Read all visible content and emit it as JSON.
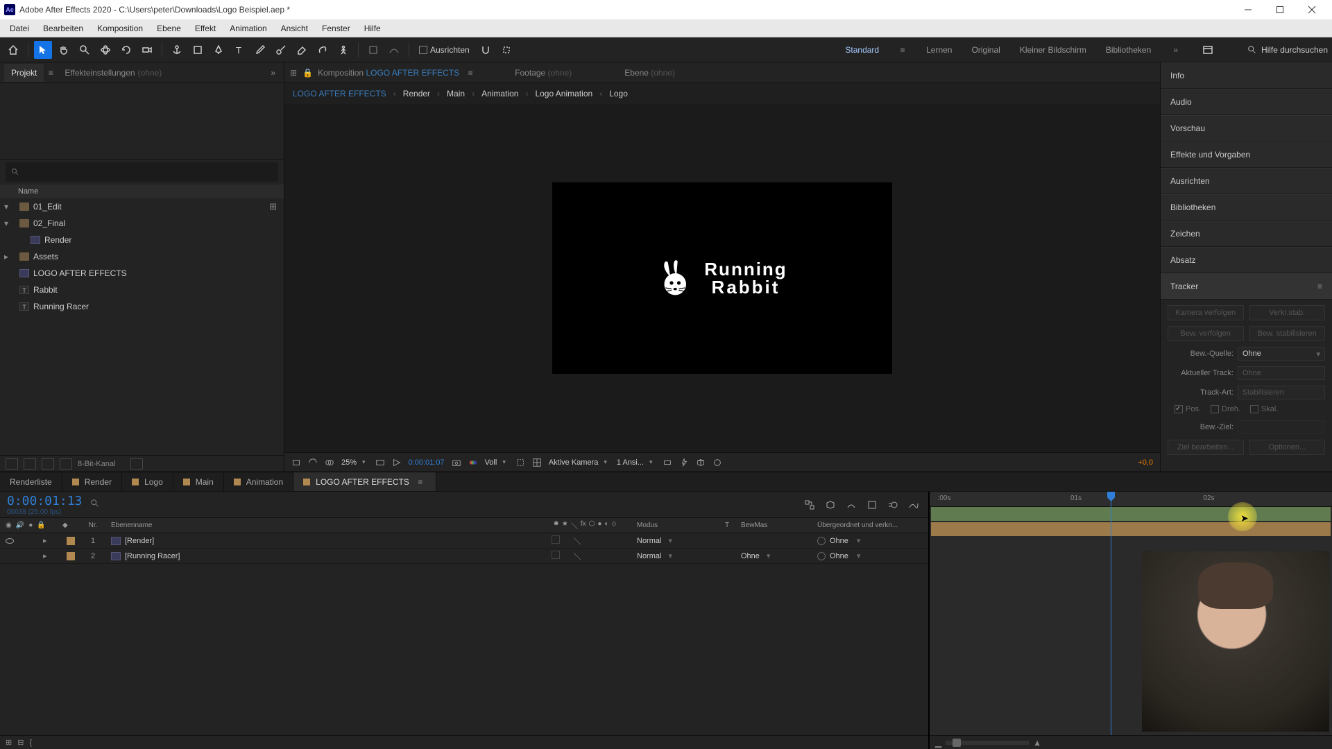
{
  "titlebar": {
    "app_icon_text": "Ae",
    "title": "Adobe After Effects 2020 - C:\\Users\\peter\\Downloads\\Logo Beispiel.aep *"
  },
  "menubar": [
    "Datei",
    "Bearbeiten",
    "Komposition",
    "Ebene",
    "Effekt",
    "Animation",
    "Ansicht",
    "Fenster",
    "Hilfe"
  ],
  "toolbar": {
    "align_label": "Ausrichten",
    "workspaces": [
      "Standard",
      "Lernen",
      "Original",
      "Kleiner Bildschirm",
      "Bibliotheken"
    ],
    "active_workspace": "Standard",
    "help_placeholder": "Hilfe durchsuchen"
  },
  "left_panel": {
    "tabs": [
      {
        "label": "Projekt",
        "active": true
      },
      {
        "label": "Effekteinstellungen",
        "suffix": "(ohne)",
        "active": false
      }
    ],
    "header_name": "Name",
    "items": [
      {
        "kind": "folder",
        "label": "01_Edit",
        "expanded": true,
        "depth": 0,
        "has_reveal": true
      },
      {
        "kind": "folder",
        "label": "02_Final",
        "expanded": true,
        "depth": 0
      },
      {
        "kind": "comp",
        "label": "Render",
        "depth": 1
      },
      {
        "kind": "folder",
        "label": "Assets",
        "expanded": false,
        "depth": 0
      },
      {
        "kind": "comp",
        "label": "LOGO AFTER EFFECTS",
        "depth": 0
      },
      {
        "kind": "text",
        "label": "Rabbit",
        "depth": 0
      },
      {
        "kind": "text",
        "label": "Running Racer",
        "depth": 0
      }
    ],
    "footer": {
      "bitdepth": "8-Bit-Kanal"
    }
  },
  "comp_header": {
    "tabs": [
      {
        "prefix": "Komposition",
        "name": "LOGO AFTER EFFECTS",
        "active": true
      },
      {
        "prefix": "Footage",
        "suffix": "(ohne)"
      },
      {
        "prefix": "Ebene",
        "suffix": "(ohne)"
      }
    ],
    "breadcrumbs": [
      "LOGO AFTER EFFECTS",
      "Render",
      "Main",
      "Animation",
      "Logo Animation",
      "Logo"
    ]
  },
  "preview_logo": {
    "line1": "Running",
    "line2": "Rabbit"
  },
  "viewer_footer": {
    "zoom": "25%",
    "timecode": "0:00:01:07",
    "resolution": "Voll",
    "camera": "Aktive Kamera",
    "views": "1 Ansi...",
    "fps_offset": "+0,0"
  },
  "right_panels": [
    "Info",
    "Audio",
    "Vorschau",
    "Effekte und Vorgaben",
    "Ausrichten",
    "Bibliotheken",
    "Zeichen",
    "Absatz",
    "Tracker"
  ],
  "tracker": {
    "btn_cam": "Kamera verfolgen",
    "btn_warp": "Verkr.stab.",
    "btn_track": "Bew. verfolgen",
    "btn_stab": "Bew. stabilisieren",
    "source_label": "Bew.-Quelle:",
    "source_value": "Ohne",
    "track_label": "Aktueller Track:",
    "track_value": "Ohne",
    "type_label": "Track-Art:",
    "type_value": "Stabilisieren",
    "chk_pos": "Pos.",
    "chk_rot": "Dreh.",
    "chk_scale": "Skal.",
    "target_label": "Bew.-Ziel:",
    "btn_edit": "Ziel bearbeiten...",
    "btn_opts": "Optionen..."
  },
  "timeline": {
    "tabs": [
      {
        "label": "Renderliste",
        "swatch": null
      },
      {
        "label": "Render",
        "swatch": "#b08850"
      },
      {
        "label": "Logo",
        "swatch": "#b08850"
      },
      {
        "label": "Main",
        "swatch": "#b08850"
      },
      {
        "label": "Animation",
        "swatch": "#b08850"
      },
      {
        "label": "LOGO AFTER EFFECTS",
        "swatch": "#b08850",
        "active": true
      }
    ],
    "timecode": "0:00:01:13",
    "timecode_sub": "00038 (25.00 fps)",
    "columns": {
      "nr": "Nr.",
      "name": "Ebenenname",
      "mode": "Modus",
      "t": "T",
      "trkmat": "BewMas",
      "parent": "Übergeordnet und verkn..."
    },
    "layers": [
      {
        "nr": 1,
        "name": "[Render]",
        "swatch": "#b08850",
        "mode": "Normal",
        "trkmat": "",
        "parent": "Ohne",
        "eye": true
      },
      {
        "nr": 2,
        "name": "[Running Racer]",
        "swatch": "#b08850",
        "mode": "Normal",
        "trkmat": "Ohne",
        "parent": "Ohne",
        "eye": false
      }
    ],
    "ruler": [
      {
        "label": ":00s",
        "pct": 2
      },
      {
        "label": "01s",
        "pct": 35
      },
      {
        "label": "02s",
        "pct": 68
      }
    ],
    "playhead_pct": 45
  }
}
